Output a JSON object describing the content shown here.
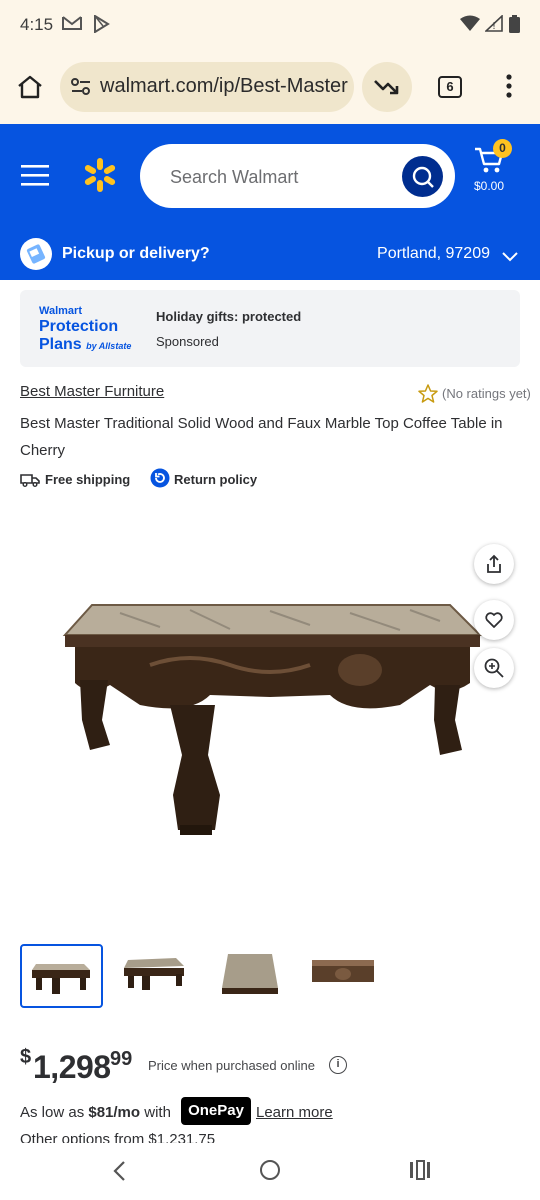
{
  "status_bar": {
    "time": "4:15",
    "icons": [
      "gmail-icon",
      "play-store-icon",
      "wifi-icon",
      "signal-icon",
      "battery-icon"
    ]
  },
  "browser": {
    "url": "walmart.com/ip/Best-Master-Furniture",
    "tab_count": "6"
  },
  "header": {
    "search_placeholder": "Search Walmart",
    "cart_count": "0",
    "cart_total": "$0.00",
    "brand_color": "#0654e0",
    "spark_color": "#ffc220"
  },
  "pickup": {
    "label": "Pickup or delivery?",
    "location": "Portland, 97209"
  },
  "ad": {
    "logo_top": "Walmart",
    "logo_line1": "Protection",
    "logo_line2": "Plans",
    "logo_by": "by Allstate",
    "headline": "Holiday gifts: protected",
    "sponsored": "Sponsored"
  },
  "product": {
    "brand": "Best Master Furniture",
    "ratings": "(No ratings yet)",
    "title": "Best Master Traditional Solid Wood and Faux Marble Top Coffee Table in Cherry",
    "free_shipping": "Free shipping",
    "return_policy": "Return policy",
    "thumbnail_count": 4,
    "active_thumbnail": 1
  },
  "price": {
    "currency": "$",
    "dollars": "1,298",
    "cents": "99",
    "note": "Price when purchased online",
    "as_low_prefix": "As low as ",
    "monthly": "$81/mo",
    "with": " with",
    "onepay": "OnePay",
    "learn_more": "Learn more",
    "other_options": "Other options from $1,231.75"
  }
}
